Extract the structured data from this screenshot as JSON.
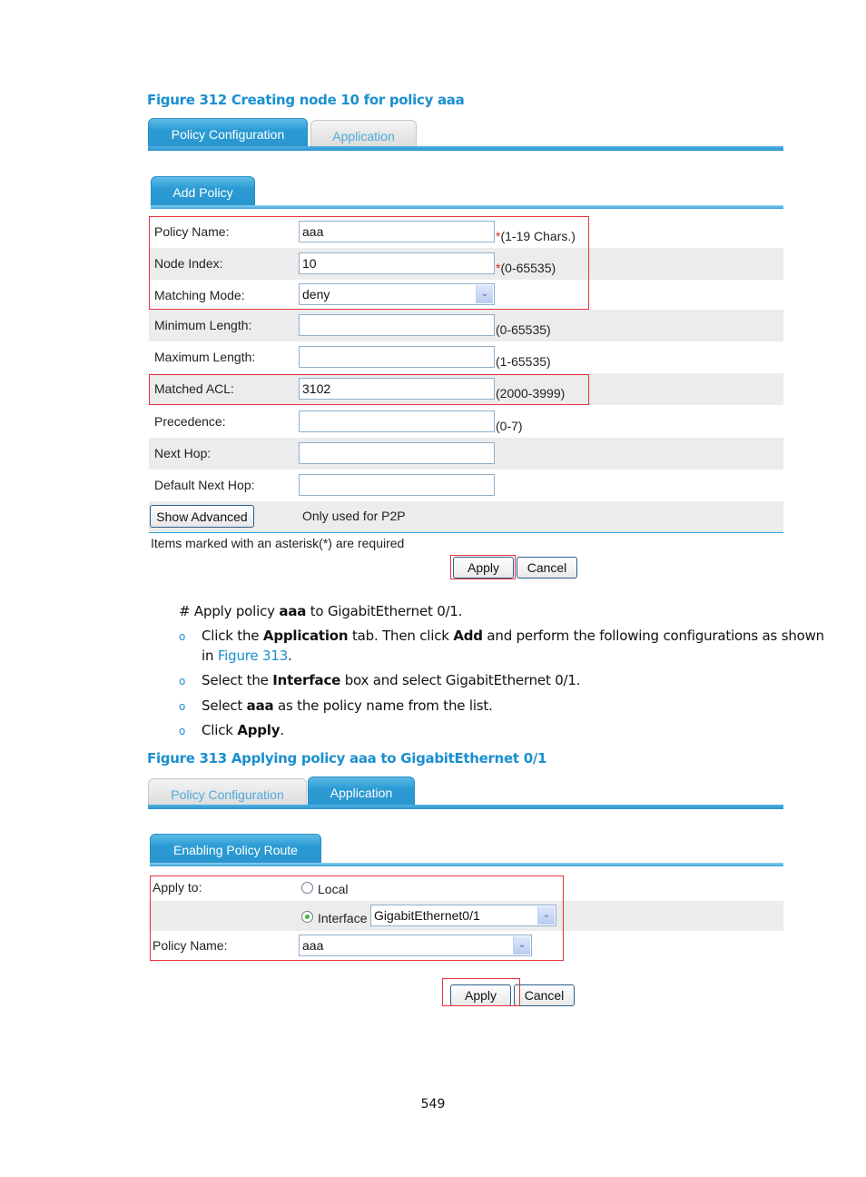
{
  "figure312": {
    "caption": "Figure 312 Creating node 10 for policy aaa",
    "tabs": [
      {
        "label": "Policy Configuration",
        "active": true
      },
      {
        "label": "Application",
        "active": false
      }
    ],
    "subtab": "Add Policy",
    "rows": [
      {
        "label": "Policy Name:",
        "value": "aaa",
        "required": true,
        "hint": "(1-19 Chars.)"
      },
      {
        "label": "Node Index:",
        "value": "10",
        "required": true,
        "hint": "(0-65535)"
      },
      {
        "label": "Matching Mode:",
        "value": "deny",
        "type": "select"
      },
      {
        "label": "Minimum Length:",
        "value": "",
        "hint": "(0-65535)"
      },
      {
        "label": "Maximum Length:",
        "value": "",
        "hint": "(1-65535)"
      },
      {
        "label": "Matched ACL:",
        "value": "3102",
        "hint": "(2000-3999)"
      },
      {
        "label": "Precedence:",
        "value": "",
        "hint": "(0-7)"
      },
      {
        "label": "Next Hop:",
        "value": ""
      },
      {
        "label": "Default Next Hop:",
        "value": ""
      }
    ],
    "asterisk": "*",
    "show_advanced": "Show Advanced",
    "p2p_note": "Only used for P2P",
    "required_note": "Items marked with an asterisk(*) are required",
    "apply": "Apply",
    "cancel": "Cancel"
  },
  "instructions": {
    "intro": {
      "pre": "# Apply policy ",
      "bold": "aaa",
      "post": " to GigabitEthernet 0/1."
    },
    "bullets": [
      {
        "pre": "Click the ",
        "b1": "Application",
        "mid": " tab. Then click ",
        "b2": "Add",
        "post": " and perform the following configurations as shown",
        "line2_pre": "in ",
        "line2_link": "Figure 313",
        "line2_post": "."
      },
      {
        "pre": "Select the ",
        "b1": "Interface",
        "post": " box and select GigabitEthernet 0/1."
      },
      {
        "pre": "Select ",
        "b1": "aaa",
        "post": " as the policy name from the list."
      },
      {
        "pre": "Click ",
        "b1": "Apply",
        "post": "."
      }
    ],
    "bullet_glyph": "o"
  },
  "figure313": {
    "caption": "Figure 313 Applying policy aaa to GigabitEthernet 0/1",
    "tabs": [
      {
        "label": "Policy Configuration",
        "active": false
      },
      {
        "label": "Application",
        "active": true
      }
    ],
    "subtab": "Enabling Policy Route",
    "apply_to_label": "Apply to:",
    "radio_local": {
      "label": "Local",
      "checked": false
    },
    "radio_interface": {
      "label": "Interface",
      "checked": true
    },
    "interface_value": "GigabitEthernet0/1",
    "policy_name_label": "Policy Name:",
    "policy_name_value": "aaa",
    "apply": "Apply",
    "cancel": "Cancel"
  },
  "icons": {
    "select_arrow": "⌄"
  },
  "page_number": "549"
}
